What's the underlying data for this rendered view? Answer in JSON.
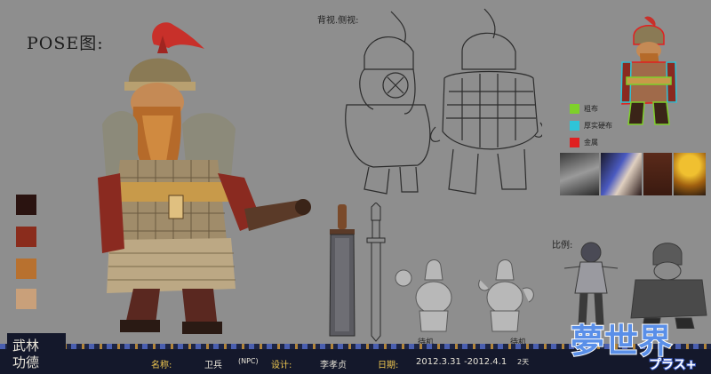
{
  "sheet": {
    "pose_title": "POSE图:",
    "back_side_label": "背视.侧视:",
    "ratio_label": "比例:",
    "idle_labels": [
      "待机",
      "待机"
    ]
  },
  "palette_colors": [
    "#2a1310",
    "#8a2c1c",
    "#b8712f",
    "#c9a07a"
  ],
  "material_legend": [
    {
      "label": "粗布",
      "color": "#7ed02a"
    },
    {
      "label": "厚实硬布",
      "color": "#2ec4d8"
    },
    {
      "label": "金属",
      "color": "#e02020"
    }
  ],
  "footer": {
    "name_label": "名称:",
    "name_value": "卫兵",
    "npc_tag": "(NPC)",
    "designer_label": "设计:",
    "designer_value": "李孝贞",
    "date_label": "日期:",
    "date_range": "2012.3.31 -2012.4.1",
    "days": "2天"
  },
  "game_logo": {
    "title": "夢世界",
    "sub": "プラス+"
  },
  "studio_logo": {
    "line1": "武林",
    "line2": "功德"
  }
}
